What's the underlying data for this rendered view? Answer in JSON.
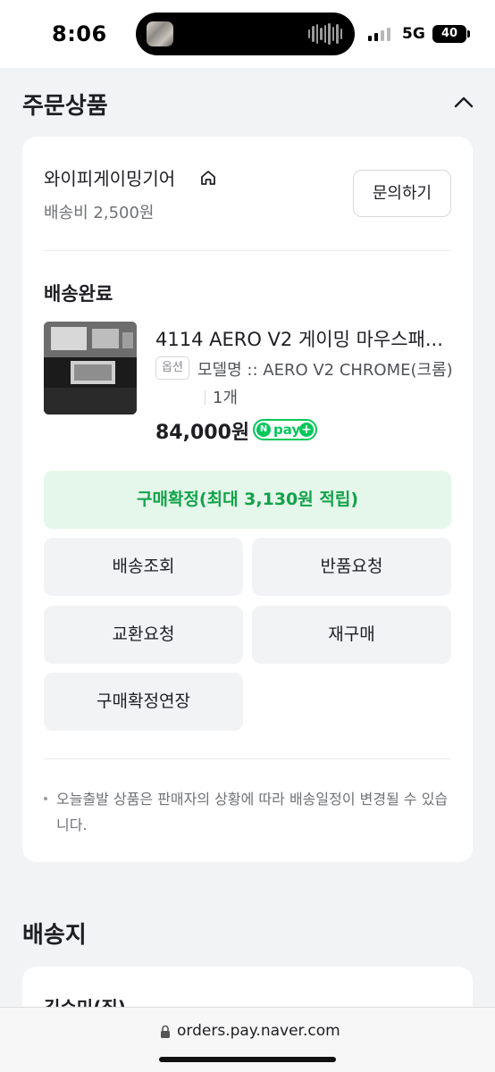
{
  "status_bar": {
    "time": "8:06",
    "network": "5G",
    "battery": "40",
    "icons": [
      "signal-icon",
      "battery-icon",
      "now-playing-thumbnail",
      "waveform-icon"
    ]
  },
  "order_section": {
    "title": "주문상품",
    "collapse_icon": "chevron-up-icon",
    "seller_name": "와이피게이밍기어",
    "seller_icon": "home-icon",
    "shipping_fee": "배송비 2,500원",
    "inquiry_label": "문의하기",
    "delivery_status": "배송완료",
    "product": {
      "name": "4114 AERO V2 게이밍 마우스패...",
      "option_badge": "옵션",
      "option_text": "모델명 :: AERO V2 CHROME(크롬)",
      "quantity": "1개",
      "price": "84,000원",
      "pay_badge": "pay"
    },
    "confirm_label": "구매확정(최대 3,130원 적립)",
    "actions": {
      "track": "배송조회",
      "return": "반품요청",
      "exchange": "교환요청",
      "rebuy": "재구매",
      "extend": "구매확정연장"
    },
    "notice": "오늘출발 상품은 판매자의 상황에 따라 배송일정이 변경될 수 있습니다."
  },
  "address_section": {
    "title": "배송지",
    "recipient_partial": "김수미(집)"
  },
  "browser": {
    "url": "orders.pay.naver.com",
    "url_icon": "lock-icon"
  },
  "colors": {
    "accent_green": "#03c75a",
    "confirm_bg": "#e5f7ea",
    "confirm_text": "#12a24a",
    "page_bg": "#f2f3f5"
  }
}
